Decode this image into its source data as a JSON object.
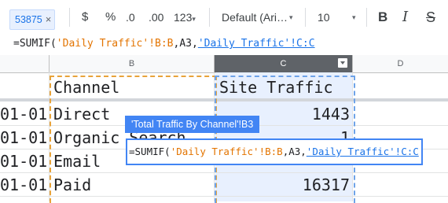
{
  "toolbar": {
    "cell_ref": "53875",
    "close_glyph": "×",
    "currency": "$",
    "percent": "%",
    "decrease_decimals": ".0",
    "increase_decimals": ".00",
    "more_formats": "123",
    "font_family": "Default (Ari…",
    "font_size": "10",
    "bold": "B",
    "italic": "I",
    "strikethrough": "S",
    "caret": "▾"
  },
  "formula_bar": {
    "part1": "=SUMIF(",
    "part2": "'Daily Traffic'!B:B",
    "part3": ",A3,",
    "part4": "'Daily Traffic'!C:C"
  },
  "columns": [
    "B",
    "C",
    "D"
  ],
  "rows": [
    {
      "date": "01-01",
      "channel": "Channel",
      "traffic": "Site Traffic"
    },
    {
      "date": "01-01",
      "channel": "Direct",
      "traffic": "1443"
    },
    {
      "date": "01-01",
      "channel": "Organic Search",
      "traffic": "1"
    },
    {
      "date": "01-01",
      "channel": "Email",
      "traffic": ""
    },
    {
      "date": "01-01",
      "channel": "Paid",
      "traffic": "16317"
    }
  ],
  "tooltip": "'Total Traffic By Channel'!B3",
  "editor": {
    "part1": "=SUMIF(",
    "part2": "'Daily Traffic'!B:B",
    "part3": ",A3,",
    "part4": "'Daily Traffic'!C:C"
  },
  "icons": [
    "close-icon",
    "chevron-down-icon",
    "filter-icon"
  ],
  "colors": {
    "accent": "#4285f4",
    "range_orange": "#e37400",
    "range_blue": "#1a73e8",
    "selected_header": "#5f6368"
  }
}
